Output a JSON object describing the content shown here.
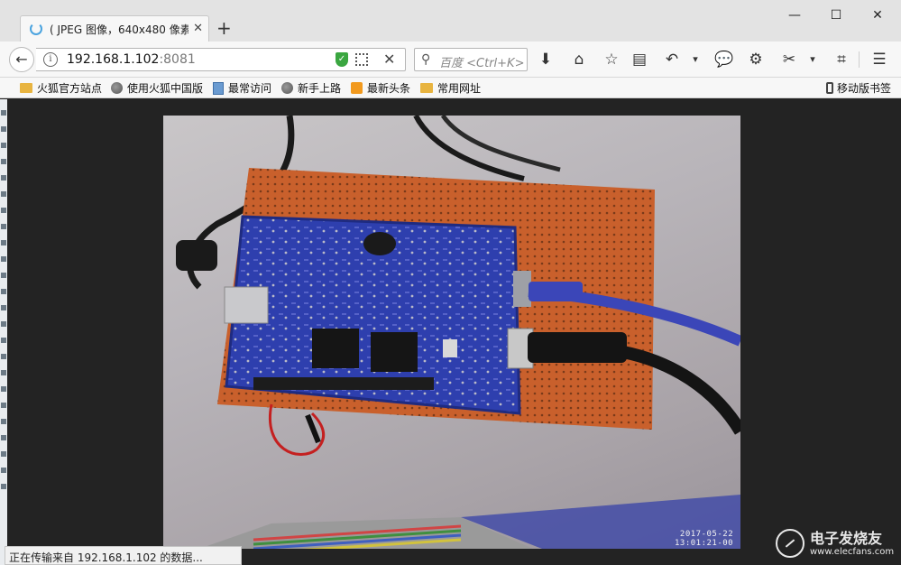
{
  "tab": {
    "title": "( JPEG 图像，640x480 像素)"
  },
  "window": {
    "minimize": "—",
    "maximize": "☐",
    "close": "✕"
  },
  "nav": {
    "url_host": "192.168.1.102",
    "url_port": ":8081",
    "search_placeholder": "百度 <Ctrl+K>",
    "icons": [
      "download-icon",
      "home-icon",
      "bookmark-star-icon",
      "reader-icon",
      "history-back-icon",
      "chat-icon",
      "extension-icon",
      "screenshot-icon",
      "crop-icon",
      "menu-icon"
    ]
  },
  "bookmarks": [
    {
      "label": "火狐官方站点",
      "icon": "folder-icon"
    },
    {
      "label": "使用火狐中国版",
      "icon": "globe-icon"
    },
    {
      "label": "最常访问",
      "icon": "page-icon"
    },
    {
      "label": "新手上路",
      "icon": "globe-icon"
    },
    {
      "label": "最新头条",
      "icon": "rss-icon"
    },
    {
      "label": "常用网址",
      "icon": "folder-icon"
    }
  ],
  "mobile_bookmarks": "移动版书签",
  "image": {
    "timestamp_date": "2017-05-22",
    "timestamp_time": "13:01:21-00"
  },
  "status_text": "正在传输来自 192.168.1.102 的数据...",
  "watermark": {
    "cn": "电子发烧友",
    "en": "www.elecfans.com"
  }
}
